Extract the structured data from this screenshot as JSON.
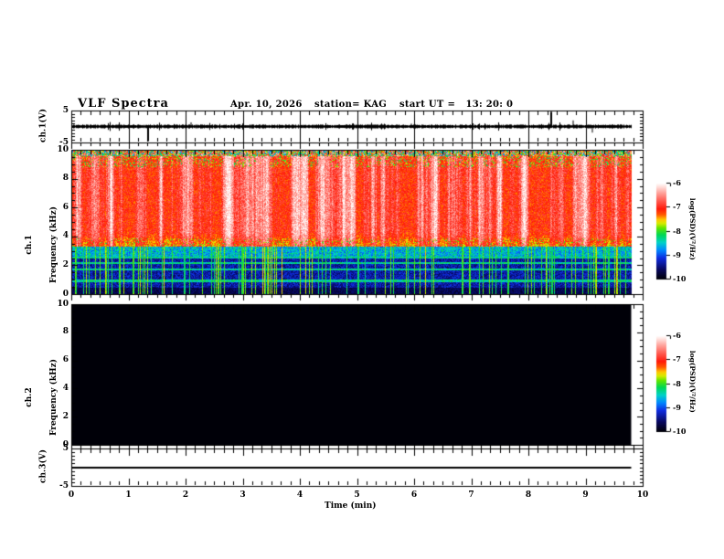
{
  "header": {
    "title": "VLF Spectra",
    "date": "Apr. 10, 2026",
    "station": "station= KAG",
    "start_ut": "start UT =   13: 20: 0"
  },
  "xaxis": {
    "label": "Time (min)",
    "ticks": [
      "0",
      "1",
      "2",
      "3",
      "4",
      "5",
      "6",
      "7",
      "8",
      "9",
      "10"
    ],
    "range_min": [
      0,
      10
    ],
    "minor_ticks_per_minute": 6
  },
  "panels": {
    "ch1_wave": {
      "ylabel": "ch.1(V)",
      "yticks": [
        "5",
        "-5"
      ],
      "ytick_values": [
        5,
        -5
      ]
    },
    "ch1_spec": {
      "ylabel_line1": "ch.1",
      "ylabel_line2": "Frequency (kHz)",
      "yticks": [
        "10",
        "8",
        "6",
        "4",
        "2",
        "0"
      ],
      "ytick_values": [
        10,
        8,
        6,
        4,
        2,
        0
      ]
    },
    "ch2_spec": {
      "ylabel_line1": "ch.2",
      "ylabel_line2": "Frequency (kHz)",
      "yticks": [
        "10",
        "8",
        "6",
        "4",
        "2",
        "0"
      ],
      "ytick_values": [
        10,
        8,
        6,
        4,
        2,
        0
      ]
    },
    "ch3_wave": {
      "ylabel": "ch.3(V)",
      "yticks": [
        "5",
        "-5"
      ],
      "ytick_values": [
        5,
        -5
      ]
    }
  },
  "colorbars": [
    {
      "label": "log(PSD)(V²/Hz)",
      "ticks": [
        "-6",
        "-7",
        "-8",
        "-9",
        "-10"
      ],
      "tick_values": [
        -6,
        -7,
        -8,
        -9,
        -10
      ]
    },
    {
      "label": "log(PSD)(V²/Hz)",
      "ticks": [
        "-6",
        "-7",
        "-8",
        "-9",
        "-10"
      ],
      "tick_values": [
        -6,
        -7,
        -8,
        -9,
        -10
      ]
    }
  ],
  "chart_data": [
    {
      "id": "ch1_waveform",
      "type": "line",
      "title": "ch.1 voltage waveform",
      "ylabel": "ch.1(V)",
      "ylim": [
        -5,
        5
      ],
      "x_range_min": [
        0,
        10
      ],
      "data_end_min": 9.8,
      "baseline": 0,
      "noise_amplitude_v": 0.35,
      "spikes": [
        {
          "t_min": 1.35,
          "v": -4.6
        },
        {
          "t_min": 2.1,
          "v": 1.3
        },
        {
          "t_min": 5.95,
          "v": 0.9
        },
        {
          "t_min": 8.4,
          "v": 4.6
        },
        {
          "t_min": 8.78,
          "v": 1.9
        },
        {
          "t_min": 9.12,
          "v": -1.9
        }
      ],
      "grid_lines_min": [
        1,
        2,
        3,
        4,
        5,
        6,
        7,
        8,
        9
      ],
      "seed": 20260410
    },
    {
      "id": "ch1_spectrogram",
      "type": "heatmap",
      "title": "ch.1 VLF spectrogram",
      "ylabel": "ch.1 Frequency (kHz)",
      "ylim": [
        0,
        10
      ],
      "x_range_min": [
        0,
        10
      ],
      "data_end_min": 9.8,
      "psd_scale": {
        "min": -10,
        "max": -6,
        "label": "log(PSD)(V²/Hz)"
      },
      "bands": [
        {
          "f_khz": [
            3.3,
            9.6
          ],
          "psd_range": [
            -7.2,
            -6.0
          ],
          "note": "intense red with saturated white patches"
        },
        {
          "f_khz": [
            9.6,
            10.0
          ],
          "psd_range": [
            -8.6,
            -6.6
          ],
          "note": "multicolor speckle at top edge"
        },
        {
          "f_khz": [
            2.6,
            3.3
          ],
          "psd_range": [
            -8.8,
            -7.8
          ],
          "note": "blue-cyan transition band"
        },
        {
          "f_khz": [
            0.0,
            2.6
          ],
          "psd_range": [
            -10.0,
            -9.2
          ],
          "note": "dark background with blue speckle"
        }
      ],
      "enhanced_lines_khz": [
        0.95,
        1.75,
        2.2,
        2.55
      ],
      "vertical_streaks": {
        "fraction_of_columns": 0.18,
        "psd": -8.2,
        "f_extent_khz": [
          0,
          3.8
        ]
      },
      "seed": 77421
    },
    {
      "id": "ch2_spectrogram",
      "type": "heatmap",
      "title": "ch.2 VLF spectrogram (no signal)",
      "ylabel": "ch.2 Frequency (kHz)",
      "ylim": [
        0,
        10
      ],
      "x_range_min": [
        0,
        10
      ],
      "data_end_min": 9.8,
      "psd_scale": {
        "min": -10,
        "max": -6,
        "label": "log(PSD)(V²/Hz)"
      },
      "uniform_psd": -10
    },
    {
      "id": "ch3_waveform",
      "type": "line",
      "title": "ch.3 voltage waveform (flat)",
      "ylabel": "ch.3(V)",
      "ylim": [
        -5,
        5
      ],
      "x_range_min": [
        0,
        10
      ],
      "data_end_min": 9.8,
      "constant_v": 0
    }
  ]
}
